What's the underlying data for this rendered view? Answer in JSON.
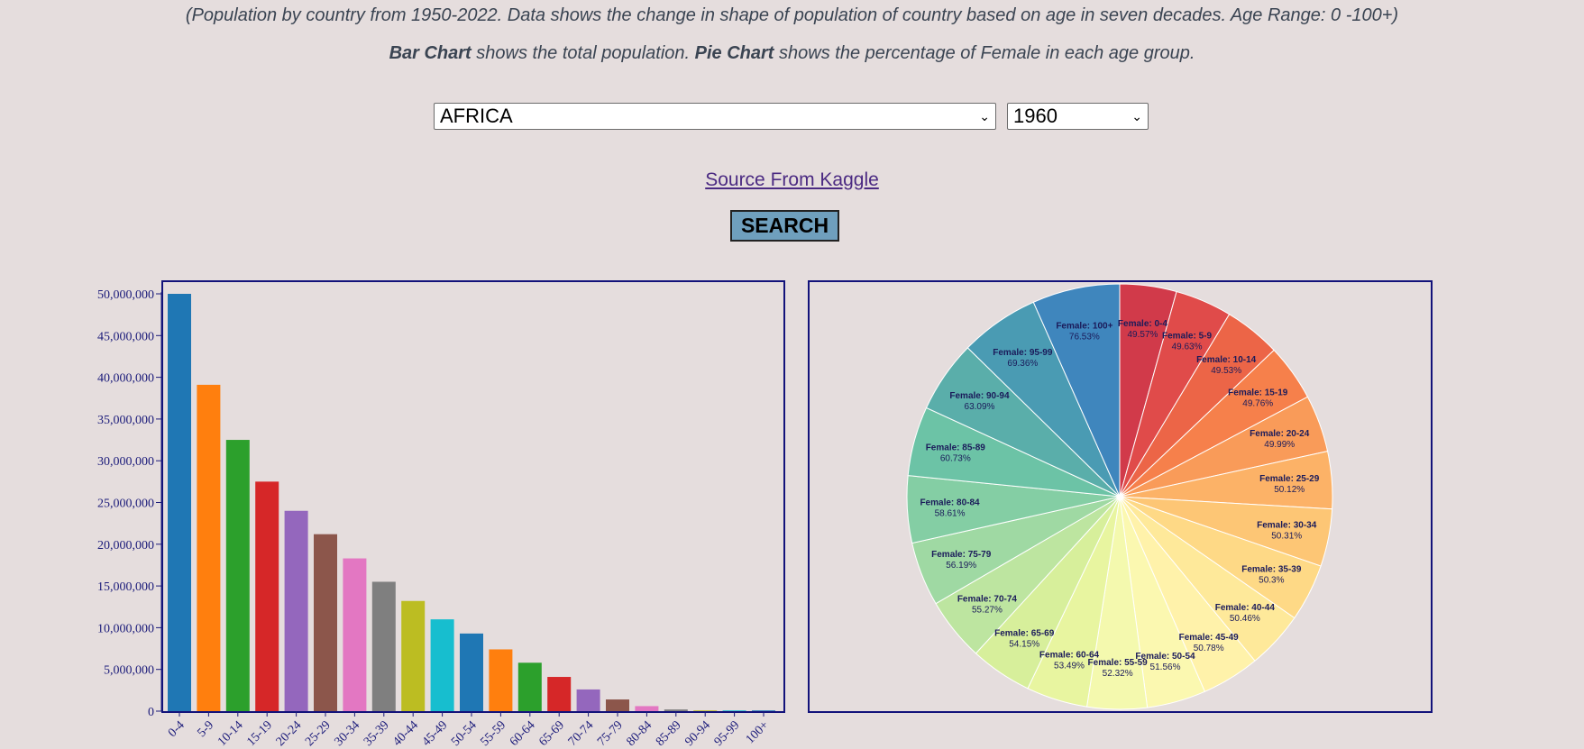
{
  "header": {
    "subtitle_1": "(Population by country from 1950-2022. Data shows the change in shape of population of country based on age in seven decades. Age Range: 0 -100+)",
    "subtitle_2_bold_1": "Bar Chart",
    "subtitle_2_text_1": " shows the total population. ",
    "subtitle_2_bold_2": "Pie Chart",
    "subtitle_2_text_2": " shows the percentage of Female in each age group."
  },
  "controls": {
    "country_value": "AFRICA",
    "year_value": "1960",
    "source_link": "Source From Kaggle",
    "search_label": "SEARCH"
  },
  "chart_data": [
    {
      "type": "bar",
      "categories": [
        "0-4",
        "5-9",
        "10-14",
        "15-19",
        "20-24",
        "25-29",
        "30-34",
        "35-39",
        "40-44",
        "45-49",
        "50-54",
        "55-59",
        "60-64",
        "65-69",
        "70-74",
        "75-79",
        "80-84",
        "85-89",
        "90-94",
        "95-99",
        "100+"
      ],
      "values": [
        50000000,
        39100000,
        32500000,
        27500000,
        24000000,
        21200000,
        18300000,
        15500000,
        13200000,
        11000000,
        9300000,
        7400000,
        5800000,
        4100000,
        2600000,
        1400000,
        600000,
        200000,
        50000,
        10000,
        2000
      ],
      "colors": [
        "#1f77b4",
        "#ff7f0e",
        "#2ca02c",
        "#d62728",
        "#9467bd",
        "#8c564b",
        "#e377c2",
        "#7f7f7f",
        "#bcbd22",
        "#17becf",
        "#1f77b4",
        "#ff7f0e",
        "#2ca02c",
        "#d62728",
        "#9467bd",
        "#8c564b",
        "#e377c2",
        "#7f7f7f",
        "#bcbd22",
        "#17becf",
        "#1f77b4"
      ],
      "yticks": [
        0,
        5000000,
        10000000,
        15000000,
        20000000,
        25000000,
        30000000,
        35000000,
        40000000,
        45000000,
        50000000
      ],
      "ytick_labels": [
        "0",
        "5,000,000",
        "10,000,000",
        "15,000,000",
        "20,000,000",
        "25,000,000",
        "30,000,000",
        "35,000,000",
        "40,000,000",
        "45,000,000",
        "50,000,000"
      ],
      "ylim": [
        0,
        50000000
      ]
    },
    {
      "type": "pie",
      "labels": [
        "Female: 0-4",
        "Female: 5-9",
        "Female: 10-14",
        "Female: 15-19",
        "Female: 20-24",
        "Female: 25-29",
        "Female: 30-34",
        "Female: 35-39",
        "Female: 40-44",
        "Female: 45-49",
        "Female: 50-54",
        "Female: 55-59",
        "Female: 60-64",
        "Female: 65-69",
        "Female: 70-74",
        "Female: 75-79",
        "Female: 80-84",
        "Female: 85-89",
        "Female: 90-94",
        "Female: 95-99",
        "Female: 100+"
      ],
      "value_labels": [
        "49.57%",
        "49.63%",
        "49.53%",
        "49.76%",
        "49.99%",
        "50.12%",
        "50.31%",
        "50.3%",
        "50.46%",
        "50.78%",
        "51.56%",
        "52.32%",
        "53.49%",
        "54.15%",
        "55.27%",
        "56.19%",
        "58.61%",
        "60.73%",
        "63.09%",
        "69.36%",
        "76.53%"
      ],
      "values": [
        49.57,
        49.63,
        49.53,
        49.76,
        49.99,
        50.12,
        50.31,
        50.3,
        50.46,
        50.78,
        51.56,
        52.32,
        53.49,
        54.15,
        55.27,
        56.19,
        58.61,
        60.73,
        63.09,
        69.36,
        76.53
      ],
      "colors": [
        "#d13a4a",
        "#e04b4a",
        "#ec6547",
        "#f6804b",
        "#f99b59",
        "#fcb267",
        "#fdc675",
        "#fed986",
        "#fee99a",
        "#fff2aa",
        "#fbf8b0",
        "#f4f9ae",
        "#e8f5a0",
        "#d7ef9b",
        "#bde5a0",
        "#9fd9a3",
        "#84cea4",
        "#6cc3a6",
        "#5aaeaa",
        "#4a9bb3",
        "#3f86bd"
      ]
    }
  ]
}
